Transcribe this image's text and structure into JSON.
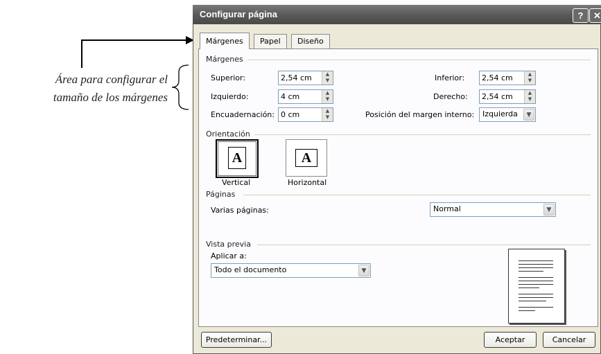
{
  "annotation": {
    "line1": "Área para configurar el",
    "line2": "tamaño de los márgenes"
  },
  "window": {
    "title": "Configurar página",
    "help_glyph": "?",
    "close_glyph": "✕"
  },
  "tabs": [
    {
      "label": "Márgenes",
      "active": true
    },
    {
      "label": "Papel",
      "active": false
    },
    {
      "label": "Diseño",
      "active": false
    }
  ],
  "margins_section": {
    "title": "Márgenes",
    "superior_label": "Superior:",
    "superior_value": "2,54 cm",
    "izquierdo_label": "Izquierdo:",
    "izquierdo_value": "4 cm",
    "encuadernacion_label": "Encuadernación:",
    "encuadernacion_value": "0 cm",
    "inferior_label": "Inferior:",
    "inferior_value": "2,54 cm",
    "derecho_label": "Derecho:",
    "derecho_value": "2,54 cm",
    "posicion_label": "Posición del margen interno:",
    "posicion_value": "Izquierda"
  },
  "orientation_section": {
    "title": "Orientación",
    "vertical_label": "Vertical",
    "horizontal_label": "Horizontal",
    "icon_letter": "A"
  },
  "pages_section": {
    "title": "Páginas",
    "varias_label": "Varias páginas:",
    "varias_value": "Normal"
  },
  "preview_section": {
    "title": "Vista previa",
    "aplicar_label": "Aplicar a:",
    "aplicar_value": "Todo el documento"
  },
  "buttons": {
    "predeterminar": "Predeterminar...",
    "aceptar": "Aceptar",
    "cancelar": "Cancelar"
  },
  "icons": {
    "spin": "spin-arrows-icon",
    "dropdown": "chevron-down-icon"
  }
}
